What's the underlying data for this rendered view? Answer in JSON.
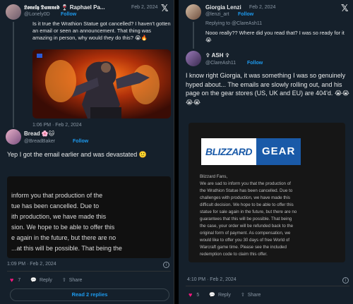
{
  "left": {
    "tweet1": {
      "author": "𝕷𝖔𝖓𝖊𝖑𝖞 𝕯𝖆𝖒𝖓𝖊𝖉 🍷 Raphael Pa...",
      "handle": "@Lonely0D",
      "date": "Feb 2, 2024",
      "follow": "Follow",
      "text": "Is it true the Wrathion Statue got cancelled? I haven't gotten an email or seen an announcement. That thing was amazing in person, why would they do this? 😭🔥"
    },
    "tweet1_time": "1:06 PM · Feb 2, 2024",
    "tweet2": {
      "author": "Bread 🌸🐱",
      "handle": "@BreadBaker",
      "follow": "Follow",
      "text": "Yep I got the email earlier and was devastated 🙂",
      "email_lines": [
        "inform you that production of the",
        "tue has been cancelled.  Due to",
        "ith production, we have made this",
        "sion.  We hope to be able to offer this",
        "e again in the future, but there are no",
        "...at this will be possible.  That being the"
      ],
      "time": "1:09 PM · Feb 2, 2024",
      "likes": "7",
      "reply": "Reply",
      "share": "Share",
      "read_replies": "Read 2 replies"
    }
  },
  "right": {
    "tweet1": {
      "author": "Giorgia Lenzi",
      "handle": "@lenzi_art",
      "date": "Feb 2, 2024",
      "follow": "Follow",
      "replying": "Replying to @ClareAsh11",
      "text": "Nooo really?? Where did you read that? I was so ready for it 😭"
    },
    "tweet2": {
      "author": "✞ ASH ✞",
      "handle": "@ClareAsh11",
      "follow": "Follow",
      "text": "I know right Giorgia, it was something I was so genuinely hyped about... The emails are slowly rolling out, and his page on the gear stores (US, UK and EU) are 404'd. 😭😭😭😭",
      "logo_left": "BLIZZARD",
      "logo_right": "GEAR",
      "email_lines": [
        "Blizzard Fans,",
        "We are sad to inform you that the production of",
        "the Wrathion Statue has been cancelled. Due to",
        "challenges with production, we have made this",
        "difficult decision. We hope to be able to offer this",
        "statue for sale again in the future, but there are no",
        "guarantees that this will be possible. That being",
        "the case, your order will be refunded back to the",
        "original form of payment. As compensation, we",
        "would like to offer you 30 days of free World of",
        "Warcraft game time. Please see the included",
        "redemption code to claim this offer."
      ],
      "time": "4:10 PM · Feb 2, 2024",
      "likes": "5",
      "reply": "Reply",
      "share": "Share"
    }
  },
  "colors": {
    "accent": "#1d9bf0",
    "like": "#f91880",
    "bg": "#15202b",
    "border": "#2f3336"
  }
}
